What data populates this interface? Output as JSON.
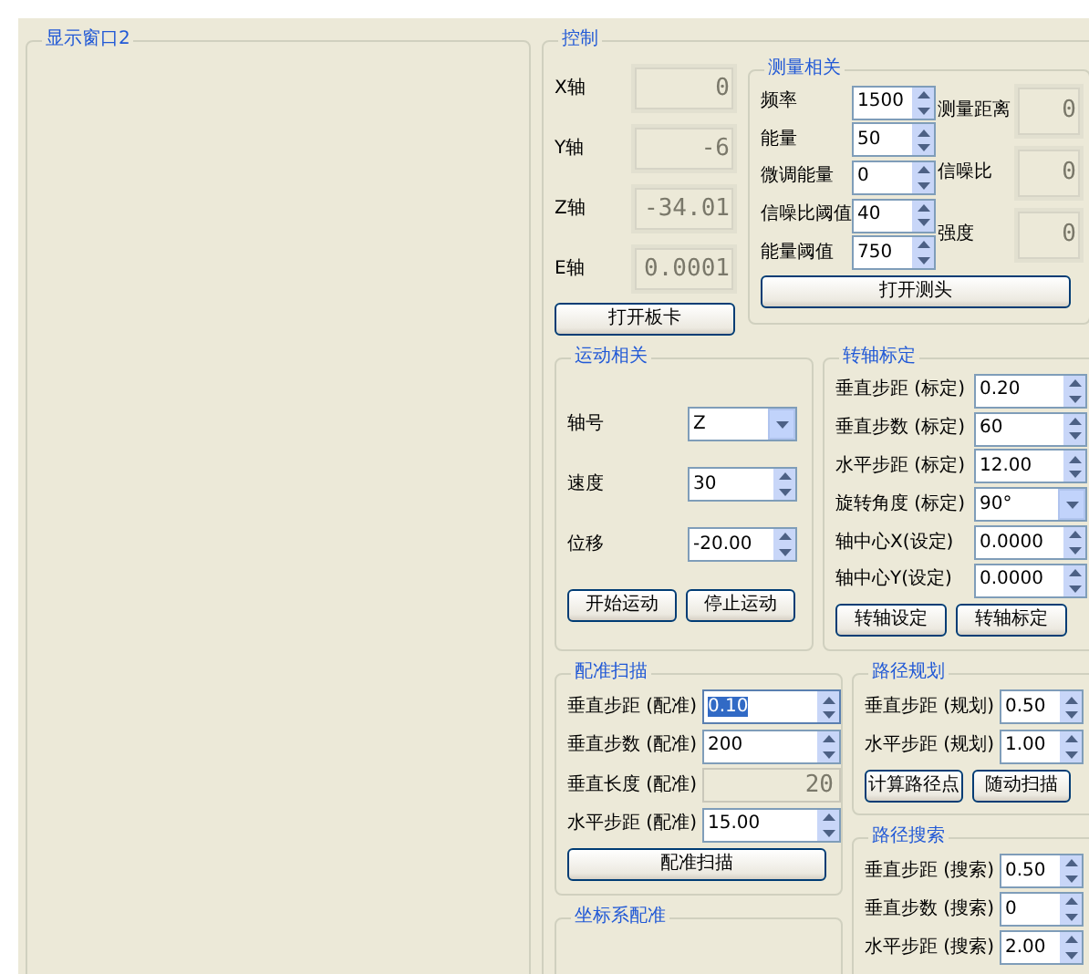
{
  "display_panel": {
    "title": "显示窗口2"
  },
  "control": {
    "title": "控制",
    "axes": [
      {
        "label": "X轴",
        "reading": "0"
      },
      {
        "label": "Y轴",
        "reading": "-6"
      },
      {
        "label": "Z轴",
        "reading": "-34.01"
      },
      {
        "label": "E轴",
        "reading": "0.0001"
      }
    ],
    "open_board_button": "打开板卡",
    "measurement": {
      "title": "测量相关",
      "fields": [
        {
          "label": "频率",
          "value": "1500"
        },
        {
          "label": "能量",
          "value": "50"
        },
        {
          "label": "微调能量",
          "value": "0"
        },
        {
          "label": "信噪比阈值",
          "value": "40"
        },
        {
          "label": "能量阈值",
          "value": "750"
        }
      ],
      "readings": [
        {
          "label": "测量距离",
          "reading": "0"
        },
        {
          "label": "信噪比",
          "reading": "0"
        },
        {
          "label": "强度",
          "reading": "0"
        }
      ],
      "button": "打开测头"
    },
    "motion": {
      "title": "运动相关",
      "fields": [
        {
          "label": "轴号",
          "value": "Z",
          "kind": "dropdown"
        },
        {
          "label": "速度",
          "value": "30",
          "kind": "spinner"
        },
        {
          "label": "位移",
          "value": "-20.00",
          "kind": "spinner"
        }
      ],
      "buttons": [
        "开始运动",
        "停止运动"
      ]
    },
    "axis_calibration": {
      "title": "转轴标定",
      "fields": [
        {
          "label": "垂直步距 (标定)",
          "value": "0.20",
          "kind": "spinner"
        },
        {
          "label": "垂直步数 (标定)",
          "value": "60",
          "kind": "spinner"
        },
        {
          "label": "水平步距 (标定)",
          "value": "12.00",
          "kind": "spinner"
        },
        {
          "label": "旋转角度 (标定)",
          "value": "90°",
          "kind": "dropdown"
        },
        {
          "label": "轴中心X(设定)",
          "value": "0.0000",
          "kind": "spinner"
        },
        {
          "label": "轴中心Y(设定)",
          "value": "0.0000",
          "kind": "spinner"
        }
      ],
      "buttons": [
        "转轴设定",
        "转轴标定"
      ]
    },
    "registration_scan": {
      "title": "配准扫描",
      "fields": [
        {
          "label": "垂直步距 (配准)",
          "value": "0.10",
          "kind": "spinner",
          "selected": true
        },
        {
          "label": "垂直步数 (配准)",
          "value": "200",
          "kind": "spinner",
          "selected": false
        },
        {
          "label": "垂直长度 (配准)",
          "value": "20",
          "kind": "display",
          "selected": false
        },
        {
          "label": "水平步距 (配准)",
          "value": "15.00",
          "kind": "spinner",
          "selected": false
        }
      ],
      "button": "配准扫描"
    },
    "coordinate_registration": {
      "title": "坐标系配准"
    },
    "path_planning": {
      "title": "路径规划",
      "fields": [
        {
          "label": "垂直步距 (规划)",
          "value": "0.50"
        },
        {
          "label": "水平步距 (规划)",
          "value": "1.00"
        }
      ],
      "buttons": [
        "计算路径点",
        "随动扫描"
      ]
    },
    "path_search": {
      "title": "路径搜索",
      "fields": [
        {
          "label": "垂直步距 (搜索)",
          "value": "0.50"
        },
        {
          "label": "垂直步数 (搜索)",
          "value": "0"
        },
        {
          "label": "水平步距 (搜索)",
          "value": "2.00"
        }
      ]
    }
  }
}
